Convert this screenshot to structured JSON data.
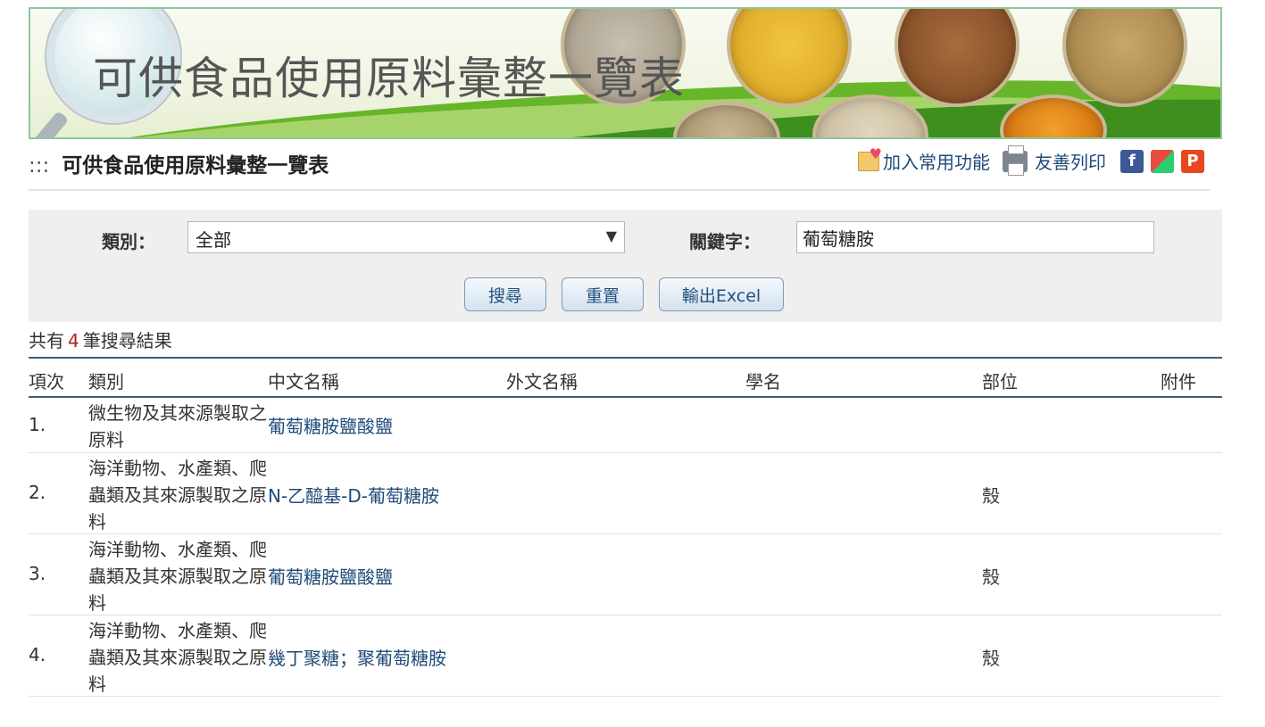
{
  "banner": {
    "title": "可供食品使用原料彙整一覽表"
  },
  "page": {
    "dots": ":::",
    "title": "可供食品使用原料彙整一覽表"
  },
  "tools": {
    "favorite": "加入常用功能",
    "print": "友善列印",
    "facebook": "f",
    "plurk": "P"
  },
  "search": {
    "category_label": "類別：",
    "category_value": "全部",
    "keyword_label": "關鍵字：",
    "keyword_value": "葡萄糖胺",
    "btn_search": "搜尋",
    "btn_reset": "重置",
    "btn_excel": "輸出Excel"
  },
  "results": {
    "prefix": "共有",
    "count": "4",
    "suffix": "筆搜尋結果"
  },
  "table": {
    "headers": [
      "項次",
      "類別",
      "中文名稱",
      "外文名稱",
      "學名",
      "部位",
      "附件"
    ],
    "rows": [
      {
        "idx": "1.",
        "category": "微生物及其來源製取之原料",
        "name": "葡萄糖胺鹽酸鹽",
        "part": ""
      },
      {
        "idx": "2.",
        "category": "海洋動物、水產類、爬蟲類及其來源製取之原料",
        "name": "N-乙醯基-D-葡萄糖胺",
        "part": "殼"
      },
      {
        "idx": "3.",
        "category": "海洋動物、水產類、爬蟲類及其來源製取之原料",
        "name": "葡萄糖胺鹽酸鹽",
        "part": "殼"
      },
      {
        "idx": "4.",
        "category": "海洋動物、水產類、爬蟲類及其來源製取之原料",
        "name": "幾丁聚糖；聚葡萄糖胺",
        "part": "殼"
      }
    ]
  }
}
